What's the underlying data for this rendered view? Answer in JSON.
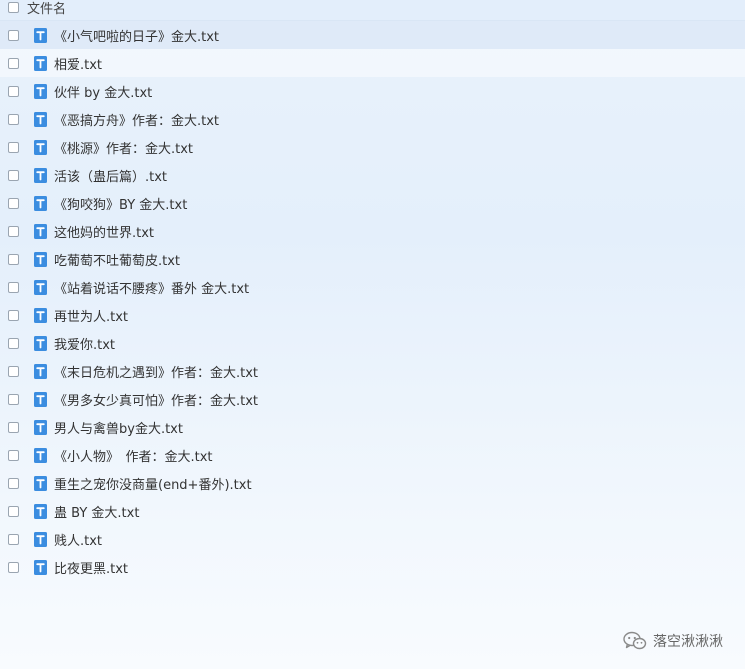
{
  "header": {
    "column_label": "文件名"
  },
  "icon": {
    "name": "text-file-icon",
    "color": "#3b8de0",
    "letter": "T"
  },
  "files": [
    {
      "name": "《小气吧啦的日子》金大.txt"
    },
    {
      "name": "相爱.txt"
    },
    {
      "name": "伙伴 by 金大.txt"
    },
    {
      "name": "《恶搞方舟》作者：金大.txt"
    },
    {
      "name": "《桃源》作者：金大.txt"
    },
    {
      "name": "活该（蛊后篇）.txt"
    },
    {
      "name": "《狗咬狗》BY 金大.txt"
    },
    {
      "name": "这他妈的世界.txt"
    },
    {
      "name": "吃葡萄不吐葡萄皮.txt"
    },
    {
      "name": "《站着说话不腰疼》番外 金大.txt"
    },
    {
      "name": "再世为人.txt"
    },
    {
      "name": "我爱你.txt"
    },
    {
      "name": "《末日危机之遇到》作者：金大.txt"
    },
    {
      "name": "《男多女少真可怕》作者：金大.txt"
    },
    {
      "name": "男人与禽兽by金大.txt"
    },
    {
      "name": "《小人物》　作者：金大.txt"
    },
    {
      "name": "重生之宠你没商量(end+番外).txt"
    },
    {
      "name": "蛊 BY 金大.txt"
    },
    {
      "name": "贱人.txt"
    },
    {
      "name": "比夜更黑.txt"
    }
  ],
  "watermark": {
    "text": "落空湫湫湫",
    "icon": "wechat-icon"
  }
}
